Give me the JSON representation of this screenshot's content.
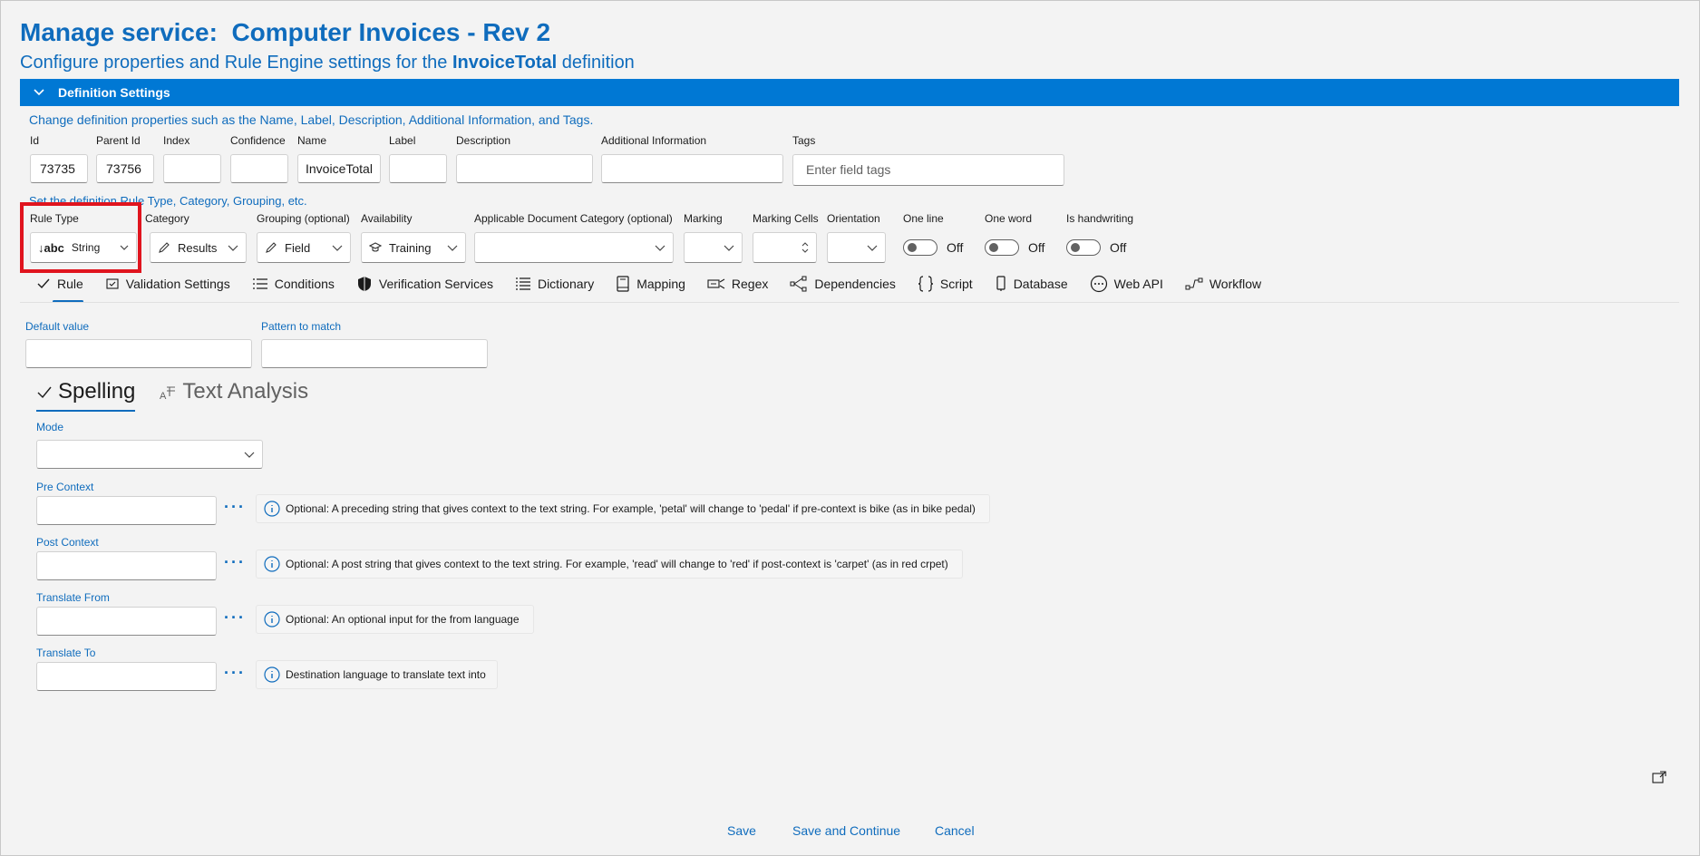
{
  "header": {
    "title_prefix": "Manage service:",
    "title_service": "Computer Invoices - Rev 2",
    "subtitle_before": "Configure properties and Rule Engine settings for the",
    "subtitle_bold": "InvoiceTotal",
    "subtitle_after": "definition"
  },
  "definition_settings": {
    "header_label": "Definition Settings",
    "hint": "Change definition properties such as the Name, Label, Description, Additional Information, and Tags.",
    "fields": {
      "id": {
        "label": "Id",
        "value": "73735"
      },
      "parent_id": {
        "label": "Parent Id",
        "value": "73756"
      },
      "index": {
        "label": "Index",
        "value": ""
      },
      "confidence": {
        "label": "Confidence",
        "value": ""
      },
      "name": {
        "label": "Name",
        "value": "InvoiceTotal"
      },
      "label": {
        "label": "Label",
        "value": ""
      },
      "description": {
        "label": "Description",
        "value": ""
      },
      "additional_info": {
        "label": "Additional Information",
        "value": ""
      },
      "tags": {
        "label": "Tags",
        "placeholder": "Enter field tags"
      }
    },
    "hint2": "Set the definition Rule Type, Category, Grouping, etc.",
    "rule_type": {
      "label": "Rule Type",
      "value": "String",
      "icon_text": "↓abc"
    },
    "category": {
      "label": "Category",
      "value": "Results"
    },
    "grouping": {
      "label": "Grouping (optional)",
      "value": "Field"
    },
    "availability": {
      "label": "Availability",
      "value": "Training"
    },
    "doc_category": {
      "label": "Applicable Document Category (optional)",
      "value": ""
    },
    "marking": {
      "label": "Marking",
      "value": ""
    },
    "marking_cells": {
      "label": "Marking Cells",
      "value": ""
    },
    "orientation": {
      "label": "Orientation",
      "value": ""
    },
    "toggles": [
      {
        "label": "One line",
        "state": "Off"
      },
      {
        "label": "One word",
        "state": "Off"
      },
      {
        "label": "Is handwriting",
        "state": "Off"
      }
    ]
  },
  "tabs": [
    {
      "label": "Rule",
      "icon": "check-icon",
      "active": true
    },
    {
      "label": "Validation Settings",
      "icon": "validation-icon"
    },
    {
      "label": "Conditions",
      "icon": "list-icon"
    },
    {
      "label": "Verification Services",
      "icon": "shield-icon"
    },
    {
      "label": "Dictionary",
      "icon": "bullet-list-icon"
    },
    {
      "label": "Mapping",
      "icon": "book-icon"
    },
    {
      "label": "Regex",
      "icon": "regex-icon"
    },
    {
      "label": "Dependencies",
      "icon": "share-icon"
    },
    {
      "label": "Script",
      "icon": "braces-icon"
    },
    {
      "label": "Database",
      "icon": "database-icon"
    },
    {
      "label": "Web API",
      "icon": "api-icon"
    },
    {
      "label": "Workflow",
      "icon": "workflow-icon"
    }
  ],
  "rule": {
    "default_value": {
      "label": "Default value",
      "value": ""
    },
    "pattern": {
      "label": "Pattern to match",
      "value": ""
    },
    "subtabs": [
      {
        "label": "Spelling",
        "active": true
      },
      {
        "label": "Text Analysis",
        "active": false
      }
    ],
    "mode": {
      "label": "Mode",
      "value": ""
    },
    "pre_context": {
      "label": "Pre Context",
      "value": "",
      "info": "Optional: A preceding string that gives context to the text string. For example, 'petal' will change to 'pedal' if pre-context is bike (as in bike pedal)"
    },
    "post_context": {
      "label": "Post Context",
      "value": "",
      "info": "Optional: A post string that gives context to the text string. For example, 'read' will change to 'red' if post-context is 'carpet' (as in red crpet)"
    },
    "translate_from": {
      "label": "Translate From",
      "value": "",
      "info": "Optional: An optional input for the from language"
    },
    "translate_to": {
      "label": "Translate To",
      "value": "",
      "info": "Destination language to translate text into"
    }
  },
  "footer": {
    "save": "Save",
    "save_continue": "Save and Continue",
    "cancel": "Cancel"
  },
  "colors": {
    "accent": "#0078d4",
    "link": "#0f6cbd",
    "highlight": "#e0141e"
  }
}
